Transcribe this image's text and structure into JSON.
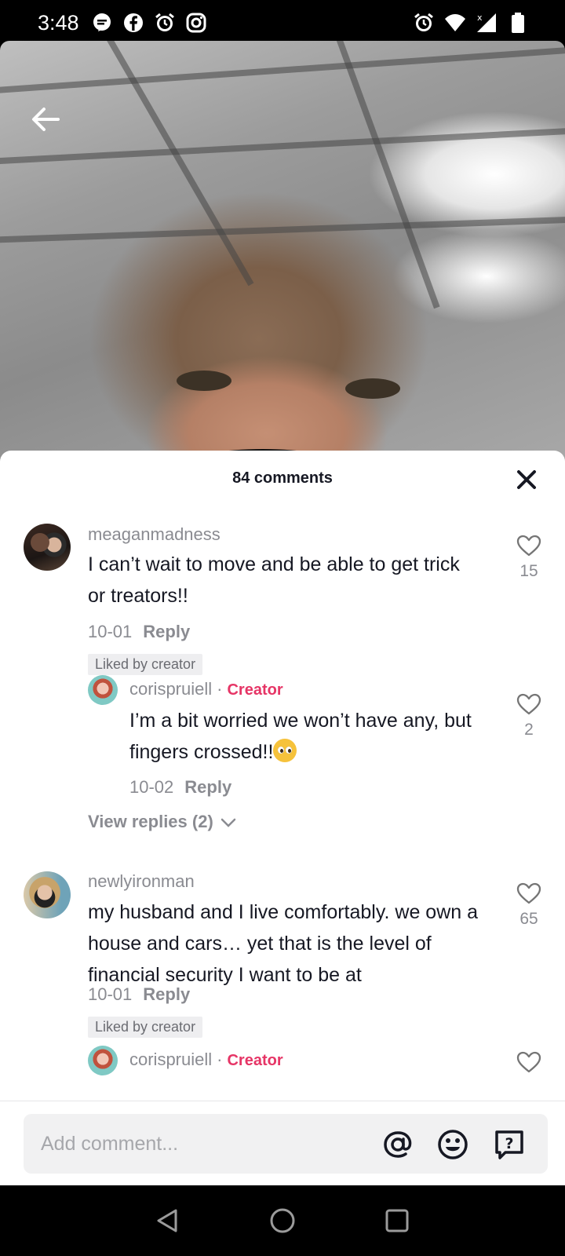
{
  "status_bar": {
    "time": "3:48",
    "left_icons": [
      "chat-bubble-icon",
      "facebook-icon",
      "alarm-icon",
      "instagram-icon"
    ],
    "right_icons": [
      "alarm-icon",
      "wifi-icon",
      "signal-icon",
      "battery-icon"
    ]
  },
  "video": {
    "back_icon": "arrow-left-icon"
  },
  "comments_sheet": {
    "title": "84 comments",
    "close_icon": "close-icon",
    "comments": [
      {
        "username": "meaganmadness",
        "text": "I can’t wait to move and be able to get trick or treators!!",
        "date": "10-01",
        "reply_label": "Reply",
        "liked_by": "Liked by creator",
        "likes": "15"
      },
      {
        "username": "corispruiell",
        "dot": "·",
        "badge": "Creator",
        "text": "I’m a bit worried we won’t have any, but fingers crossed!!",
        "emoji": "pleading-face-emoji",
        "date": "10-02",
        "reply_label": "Reply",
        "likes": "2"
      },
      {
        "username": "newlyironman",
        "text": "my husband and I live comfortably. we own a house and cars… yet that is the level of financial security I want to be at",
        "date": "10-01",
        "reply_label": "Reply",
        "liked_by": "Liked by creator",
        "likes": "65"
      },
      {
        "username": "corispruiell",
        "dot": "·",
        "badge": "Creator"
      }
    ],
    "view_replies": "View replies (2)"
  },
  "comment_input": {
    "placeholder": "Add comment...",
    "icons": [
      "mention-icon",
      "emoji-icon",
      "question-icon"
    ]
  },
  "nav_bar": {
    "icons": [
      "back-triangle-icon",
      "home-circle-icon",
      "recents-square-icon"
    ]
  }
}
